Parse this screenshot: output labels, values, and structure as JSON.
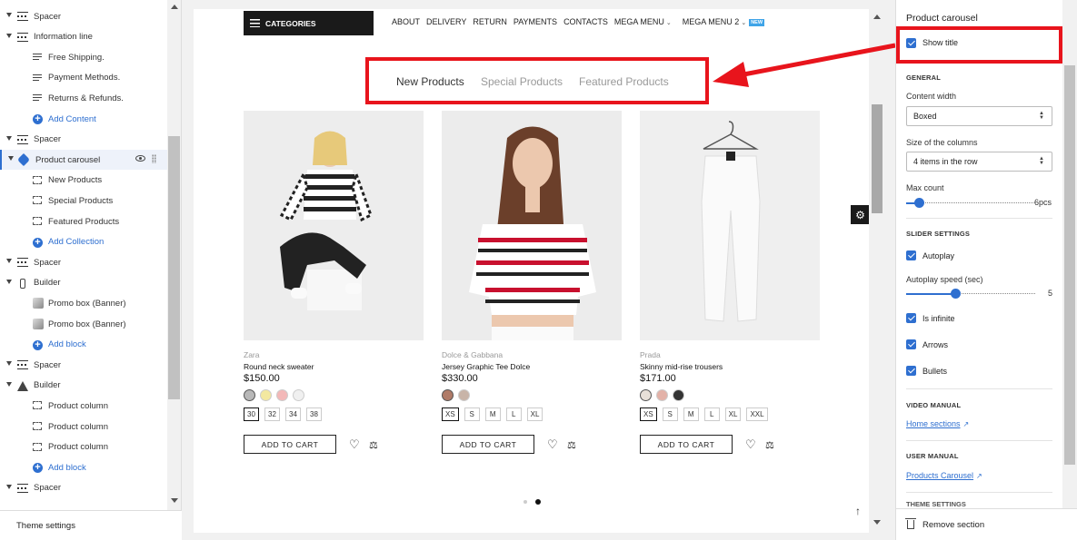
{
  "left_panel": {
    "items": [
      {
        "label": "Spacer",
        "level": 0,
        "icon": "spacer-icon"
      },
      {
        "label": "Information line",
        "level": 0,
        "icon": "spacer-icon"
      },
      {
        "label": "Free Shipping.",
        "level": 1,
        "icon": "text-lines-icon"
      },
      {
        "label": "Payment Methods.",
        "level": 1,
        "icon": "text-lines-icon"
      },
      {
        "label": "Returns & Refunds.",
        "level": 1,
        "icon": "text-lines-icon"
      },
      {
        "label": "Add Content",
        "level": 1,
        "icon": "plus-circle-icon",
        "link": true
      },
      {
        "label": "Spacer",
        "level": 0,
        "icon": "spacer-icon"
      },
      {
        "label": "Product carousel",
        "level": 0,
        "icon": "tag-icon",
        "active": true
      },
      {
        "label": "New Products",
        "level": 1,
        "icon": "dashed-box-icon"
      },
      {
        "label": "Special Products",
        "level": 1,
        "icon": "dashed-box-icon"
      },
      {
        "label": "Featured Products",
        "level": 1,
        "icon": "dashed-box-icon"
      },
      {
        "label": "Add Collection",
        "level": 1,
        "icon": "plus-circle-icon",
        "link": true
      },
      {
        "label": "Spacer",
        "level": 0,
        "icon": "spacer-icon"
      },
      {
        "label": "Builder",
        "level": 0,
        "icon": "builder-icon"
      },
      {
        "label": "Promo box (Banner)",
        "level": 1,
        "icon": "promo-thumb-icon"
      },
      {
        "label": "Promo box (Banner)",
        "level": 1,
        "icon": "promo-thumb-icon"
      },
      {
        "label": "Add block",
        "level": 1,
        "icon": "plus-circle-icon",
        "link": true
      },
      {
        "label": "Spacer",
        "level": 0,
        "icon": "spacer-icon"
      },
      {
        "label": "Builder",
        "level": 0,
        "icon": "home-icon"
      },
      {
        "label": "Product column",
        "level": 1,
        "icon": "dashed-box-icon"
      },
      {
        "label": "Product column",
        "level": 1,
        "icon": "dashed-box-icon"
      },
      {
        "label": "Product column",
        "level": 1,
        "icon": "dashed-box-icon"
      },
      {
        "label": "Add block",
        "level": 1,
        "icon": "plus-circle-icon",
        "link": true
      },
      {
        "label": "Spacer",
        "level": 0,
        "icon": "spacer-icon"
      }
    ],
    "theme_settings": "Theme settings"
  },
  "preview": {
    "categories_label": "CATEGORIES",
    "nav": [
      "ABOUT",
      "DELIVERY",
      "RETURN",
      "PAYMENTS",
      "CONTACTS",
      "MEGA MENU",
      "MEGA MENU 2"
    ],
    "new_badge": "NEW",
    "tabs": [
      "New Products",
      "Special Products",
      "Featured Products"
    ],
    "active_tab": 0,
    "add_to_cart": "ADD TO CART",
    "products": [
      {
        "brand": "Zara",
        "name": "Round neck sweater",
        "price": "$150.00",
        "sizes": [
          "30",
          "32",
          "34",
          "38"
        ],
        "selected_size": 0,
        "swatches": [
          "#b8b8b8",
          "#f3e8a0",
          "#f3b8b8",
          "#f0f0f0"
        ]
      },
      {
        "brand": "Dolce & Gabbana",
        "name": "Jersey Graphic Tee Dolce",
        "price": "$330.00",
        "sizes": [
          "XS",
          "S",
          "M",
          "L",
          "XL"
        ],
        "selected_size": 0,
        "swatches": [
          "#b07b68",
          "#c8b4a8"
        ]
      },
      {
        "brand": "Prada",
        "name": "Skinny mid-rise trousers",
        "price": "$171.00",
        "sizes": [
          "XS",
          "S",
          "M",
          "L",
          "XL",
          "XXL"
        ],
        "selected_size": 0,
        "swatches": [
          "#e8e0d8",
          "#e3b2a8",
          "#333333"
        ]
      }
    ],
    "slider_pages": 2,
    "active_page": 1
  },
  "right_panel": {
    "title": "Product carousel",
    "show_title": {
      "label": "Show title",
      "checked": true
    },
    "general": {
      "heading": "GENERAL",
      "content_width_label": "Content width",
      "content_width_value": "Boxed",
      "columns_label": "Size of the columns",
      "columns_value": "4 items in the row",
      "max_count_label": "Max count",
      "max_count_value": "6pcs",
      "max_count_fraction": 0.1
    },
    "slider_settings": {
      "heading": "SLIDER SETTINGS",
      "autoplay": {
        "label": "Autoplay",
        "checked": true
      },
      "speed_label": "Autoplay speed (sec)",
      "speed_value": "5",
      "speed_fraction": 0.38,
      "infinite": {
        "label": "Is infinite",
        "checked": true
      },
      "arrows": {
        "label": "Arrows",
        "checked": true
      },
      "bullets": {
        "label": "Bullets",
        "checked": true
      }
    },
    "video_manual": {
      "heading": "VIDEO MANUAL",
      "link": "Home sections"
    },
    "user_manual": {
      "heading": "USER MANUAL",
      "link": "Products Carousel"
    },
    "theme_settings_heading": "THEME SETTINGS",
    "remove_section": "Remove section"
  },
  "colors": {
    "accent": "#2e6fd0",
    "highlight": "#e8141c"
  }
}
